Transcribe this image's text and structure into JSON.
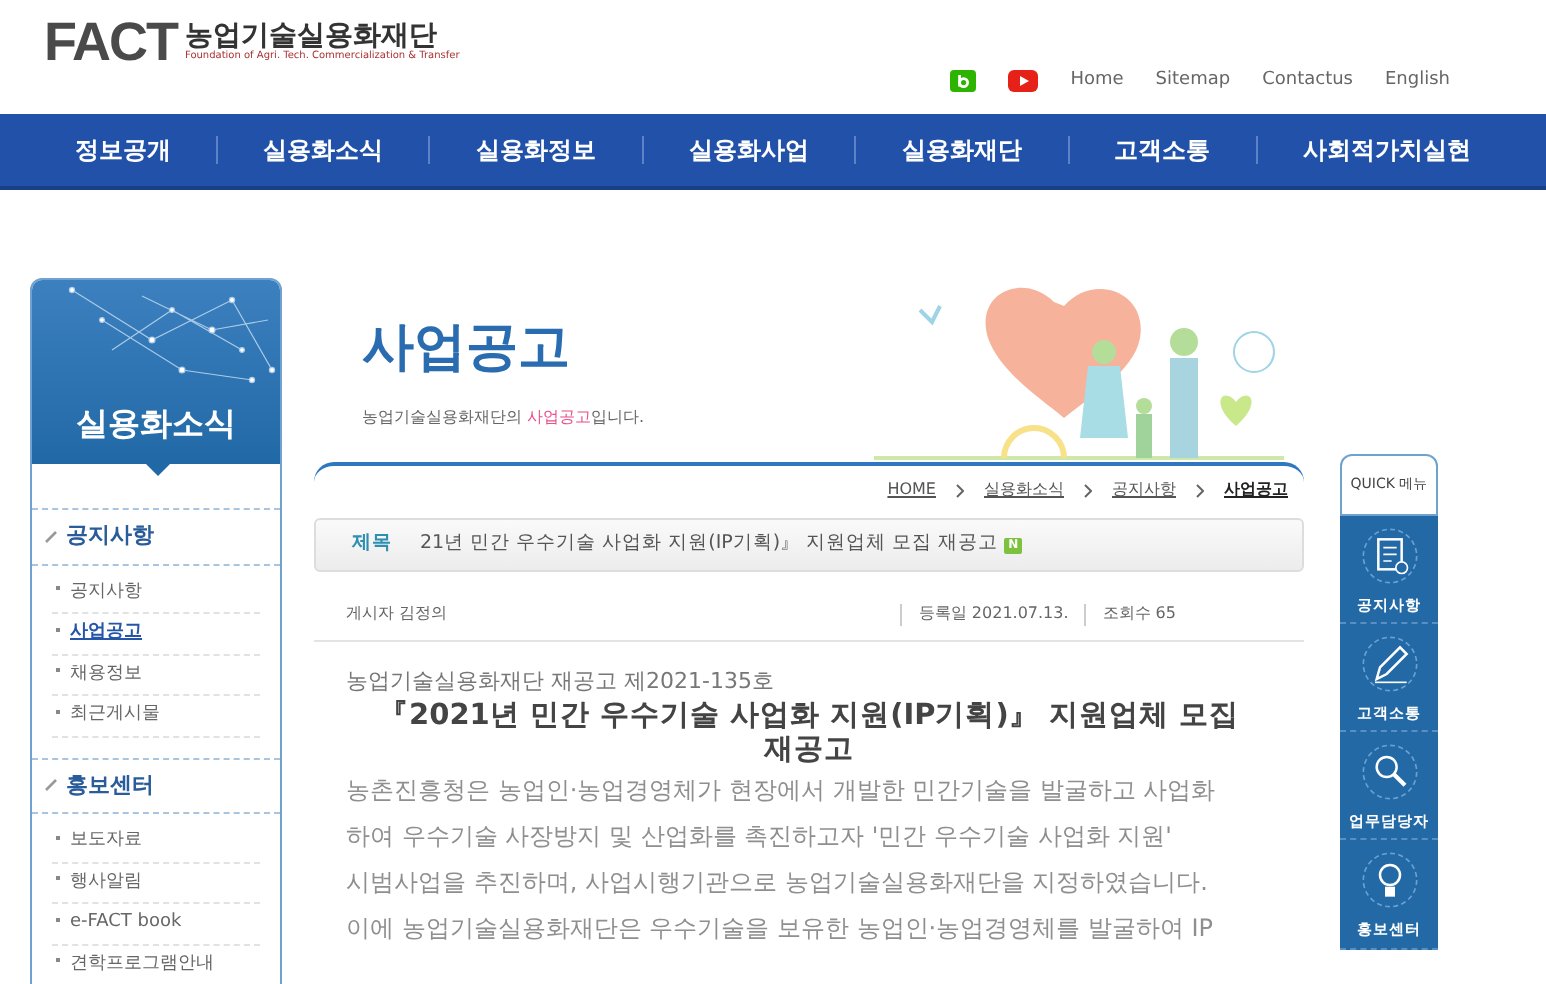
{
  "header": {
    "logo_text": "FACT",
    "org_name": "농업기술실용화재단",
    "org_tagline": "Foundation of Agri. Tech. Commercialization & Transfer",
    "util_links": [
      "Home",
      "Sitemap",
      "Contactus",
      "English"
    ]
  },
  "nav": [
    {
      "label": "정보공개",
      "selected": false
    },
    {
      "label": "실용화소식",
      "selected": false
    },
    {
      "label": "실용화정보",
      "selected": false
    },
    {
      "label": "실용화사업",
      "selected": false
    },
    {
      "label": "실용화재단",
      "selected": false
    },
    {
      "label": "고객소통",
      "selected": false
    },
    {
      "label": "사회적가치실현",
      "selected": false
    }
  ],
  "sidebar": {
    "title": "실용화소식",
    "sections": [
      {
        "title": "공지사항",
        "items": [
          {
            "label": "공지사항",
            "selected": false
          },
          {
            "label": "사업공고",
            "selected": true
          },
          {
            "label": "채용정보",
            "selected": false
          },
          {
            "label": "최근게시물",
            "selected": false
          }
        ]
      },
      {
        "title": "홍보센터",
        "items": [
          {
            "label": "보도자료",
            "selected": false
          },
          {
            "label": "행사알림",
            "selected": false
          },
          {
            "label": "e-FACT book",
            "selected": false
          },
          {
            "label": "견학프로그램안내",
            "selected": false
          }
        ]
      }
    ]
  },
  "page": {
    "title": "사업공고",
    "subtitle": [
      {
        "text": "농업기술실용화재단의 ",
        "highlight": false
      },
      {
        "text": "사업공고",
        "highlight": true
      },
      {
        "text": "입니다.",
        "highlight": false
      }
    ],
    "breadcrumb": [
      {
        "label": "HOME",
        "current": false
      },
      {
        "label": "실용화소식",
        "current": false
      },
      {
        "label": "공지사항",
        "current": false
      },
      {
        "label": "사업공고",
        "current": true
      }
    ]
  },
  "post": {
    "subject_label": "제목",
    "subject": "21년 민간 우수기술 사업화 지원(IP기획)』 지원업체 모집 재공고",
    "is_new": true,
    "new_badge": "N",
    "author_label": "게시자",
    "author": "김정의",
    "date_label": "등록일",
    "date": "2021.07.13.",
    "views_label": "조회수",
    "views": "65",
    "notice_no": "농업기술실용화재단 재공고 제2021-135호",
    "heading": "『2021년 민간 우수기술 사업화 지원(IP기획)』 지원업체 모집 재공고",
    "body_lines": [
      "농촌진흥청은 농업인·농업경영체가 현장에서 개발한 민간기술을 발굴하고 사업화",
      "하여 우수기술 사장방지 및 산업화를 촉진하고자 '민간 우수기술 사업화 지원'",
      "시범사업을 추진하며, 사업시행기관으로 농업기술실용화재단을 지정하였습니다.",
      "이에 농업기술실용화재단은 우수기술을 보유한 농업인·농업경영체를 발굴하여 IP"
    ]
  },
  "quick_menu": {
    "title": "QUICK 메뉴",
    "items": [
      {
        "label": "공지사항",
        "kind": "document"
      },
      {
        "label": "고객소통",
        "kind": "pencil"
      },
      {
        "label": "업무담당자",
        "kind": "search"
      },
      {
        "label": "홍보센터",
        "kind": "bulb"
      }
    ]
  }
}
